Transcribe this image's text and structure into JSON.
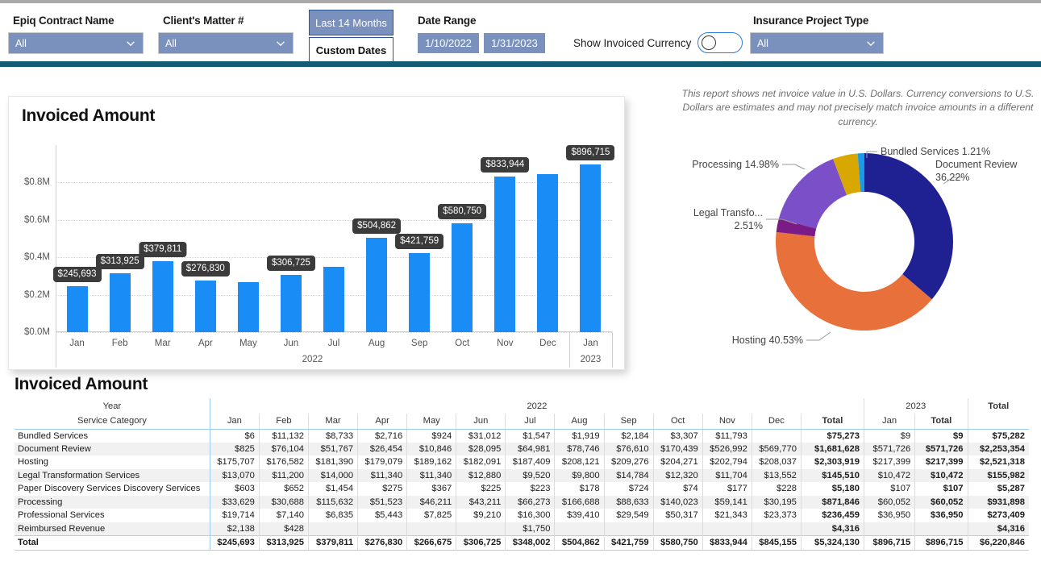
{
  "header": {
    "slicers": [
      {
        "label": "Epiq Contract Name",
        "value": "All"
      },
      {
        "label": "Client's Matter #",
        "value": "All"
      }
    ],
    "range_buttons": {
      "selected": "Last 14 Months",
      "other": "Custom Dates"
    },
    "date_range": {
      "label": "Date Range",
      "start": "1/10/2022",
      "end": "1/31/2023"
    },
    "currency_toggle": {
      "label": "Show Invoiced Currency",
      "state": "off"
    },
    "project_type": {
      "label": "Insurance Project Type",
      "value": "All"
    }
  },
  "note": "This report shows net invoice value in U.S. Dollars. Currency conversions to U.S. Dollars are estimates and may not precisely match invoice amounts in a different currency.",
  "bar_card": {
    "title": "Invoiced Amount"
  },
  "table_card": {
    "title": "Invoiced Amount"
  },
  "chart_data": [
    {
      "type": "bar",
      "title": "Invoiced Amount",
      "xlabel": "",
      "ylabel": "",
      "ylim": [
        0,
        1000000
      ],
      "grid": true,
      "ytick_labels": [
        "$0.0M",
        "$0.2M",
        "$0.4M",
        "$0.6M",
        "$0.8M"
      ],
      "ytick_values": [
        0,
        200000,
        400000,
        600000,
        800000
      ],
      "categories": [
        "Jan",
        "Feb",
        "Mar",
        "Apr",
        "May",
        "Jun",
        "Jul",
        "Aug",
        "Sep",
        "Oct",
        "Nov",
        "Dec",
        "Jan"
      ],
      "group_labels": [
        "2022",
        "2023"
      ],
      "values": [
        245693,
        313925,
        379811,
        276830,
        266675,
        306725,
        348002,
        504862,
        421759,
        580750,
        833944,
        845155,
        896715
      ],
      "data_labels": [
        "$245,693",
        "$313,925",
        "$379,811",
        "$276,830",
        "",
        "$306,725",
        "",
        "$504,862",
        "$421,759",
        "$580,750",
        "$833,944",
        "",
        "$896,715"
      ],
      "bar_color": "#1a8cf5"
    },
    {
      "type": "pie",
      "subtype": "donut",
      "title": "",
      "labels": [
        "Document Review",
        "Hosting",
        "Legal Transfo...",
        "Processing",
        "Bundled Services"
      ],
      "values": [
        36.22,
        40.53,
        2.51,
        14.98,
        1.21
      ],
      "label_texts": [
        "Document Review 36.22%",
        "Hosting 40.53%",
        "Legal Transfo... 2.51%",
        "Processing 14.98%",
        "Bundled Services 1.21%"
      ],
      "colors": [
        "#1f2193",
        "#e8703a",
        "#7a1b86",
        "#7b4fc7",
        "#1a9ae8"
      ],
      "gold_color": "#d9a800",
      "legend_position": "callout"
    }
  ],
  "table": {
    "corner_top": "Year",
    "corner_bottom": "Service Category",
    "group_2022": "2022",
    "group_2023": "2023",
    "group_total": "Total",
    "months_2022": [
      "Jan",
      "Feb",
      "Mar",
      "Apr",
      "May",
      "Jun",
      "Jul",
      "Aug",
      "Sep",
      "Oct",
      "Nov",
      "Dec"
    ],
    "total_2022": "Total",
    "months_2023": [
      "Jan"
    ],
    "total_2023": "Total",
    "grand_total": "Total",
    "rows": [
      {
        "label": "Bundled Services",
        "m2022": [
          "$6",
          "$11,132",
          "$8,733",
          "$2,716",
          "$924",
          "$31,012",
          "$1,547",
          "$1,919",
          "$2,184",
          "$3,307",
          "$11,793",
          ""
        ],
        "t2022": "$75,273",
        "m2023": [
          "$9"
        ],
        "t2023": "$9",
        "total": "$75,282"
      },
      {
        "label": "Document Review",
        "m2022": [
          "$825",
          "$76,104",
          "$51,767",
          "$26,454",
          "$10,846",
          "$28,095",
          "$64,981",
          "$78,746",
          "$76,610",
          "$170,439",
          "$526,992",
          "$569,770"
        ],
        "t2022": "$1,681,628",
        "m2023": [
          "$571,726"
        ],
        "t2023": "$571,726",
        "total": "$2,253,354"
      },
      {
        "label": "Hosting",
        "m2022": [
          "$175,707",
          "$176,582",
          "$181,390",
          "$179,079",
          "$189,162",
          "$182,091",
          "$187,409",
          "$208,121",
          "$209,276",
          "$204,271",
          "$202,794",
          "$208,037"
        ],
        "t2022": "$2,303,919",
        "m2023": [
          "$217,399"
        ],
        "t2023": "$217,399",
        "total": "$2,521,318"
      },
      {
        "label": "Legal Transformation Services",
        "m2022": [
          "$13,070",
          "$11,200",
          "$14,000",
          "$11,340",
          "$11,340",
          "$12,880",
          "$9,520",
          "$9,800",
          "$14,784",
          "$12,320",
          "$11,704",
          "$13,552"
        ],
        "t2022": "$145,510",
        "m2023": [
          "$10,472"
        ],
        "t2023": "$10,472",
        "total": "$155,982"
      },
      {
        "label": "Paper Discovery Services Discovery Services",
        "m2022": [
          "$603",
          "$652",
          "$1,454",
          "$275",
          "$367",
          "$225",
          "$223",
          "$178",
          "$724",
          "$74",
          "$177",
          "$228"
        ],
        "t2022": "$5,180",
        "m2023": [
          "$107"
        ],
        "t2023": "$107",
        "total": "$5,287"
      },
      {
        "label": "Processing",
        "m2022": [
          "$33,629",
          "$30,688",
          "$115,632",
          "$51,523",
          "$46,211",
          "$43,211",
          "$66,273",
          "$166,688",
          "$88,633",
          "$140,023",
          "$59,141",
          "$30,195"
        ],
        "t2022": "$871,846",
        "m2023": [
          "$60,052"
        ],
        "t2023": "$60,052",
        "total": "$931,898"
      },
      {
        "label": "Professional Services",
        "m2022": [
          "$19,714",
          "$7,140",
          "$6,835",
          "$5,443",
          "$7,825",
          "$9,210",
          "$16,300",
          "$39,410",
          "$29,549",
          "$50,317",
          "$21,343",
          "$23,373"
        ],
        "t2022": "$236,459",
        "m2023": [
          "$36,950"
        ],
        "t2023": "$36,950",
        "total": "$273,409"
      },
      {
        "label": "Reimbursed Revenue",
        "m2022": [
          "$2,138",
          "$428",
          "",
          "",
          "",
          "",
          "$1,750",
          "",
          "",
          "",
          "",
          ""
        ],
        "t2022": "$4,316",
        "m2023": [
          ""
        ],
        "t2023": "",
        "total": "$4,316"
      }
    ],
    "total_row": {
      "label": "Total",
      "m2022": [
        "$245,693",
        "$313,925",
        "$379,811",
        "$276,830",
        "$266,675",
        "$306,725",
        "$348,002",
        "$504,862",
        "$421,759",
        "$580,750",
        "$833,944",
        "$845,155"
      ],
      "t2022": "$5,324,130",
      "m2023": [
        "$896,715"
      ],
      "t2023": "$896,715",
      "total": "$6,220,846"
    }
  }
}
